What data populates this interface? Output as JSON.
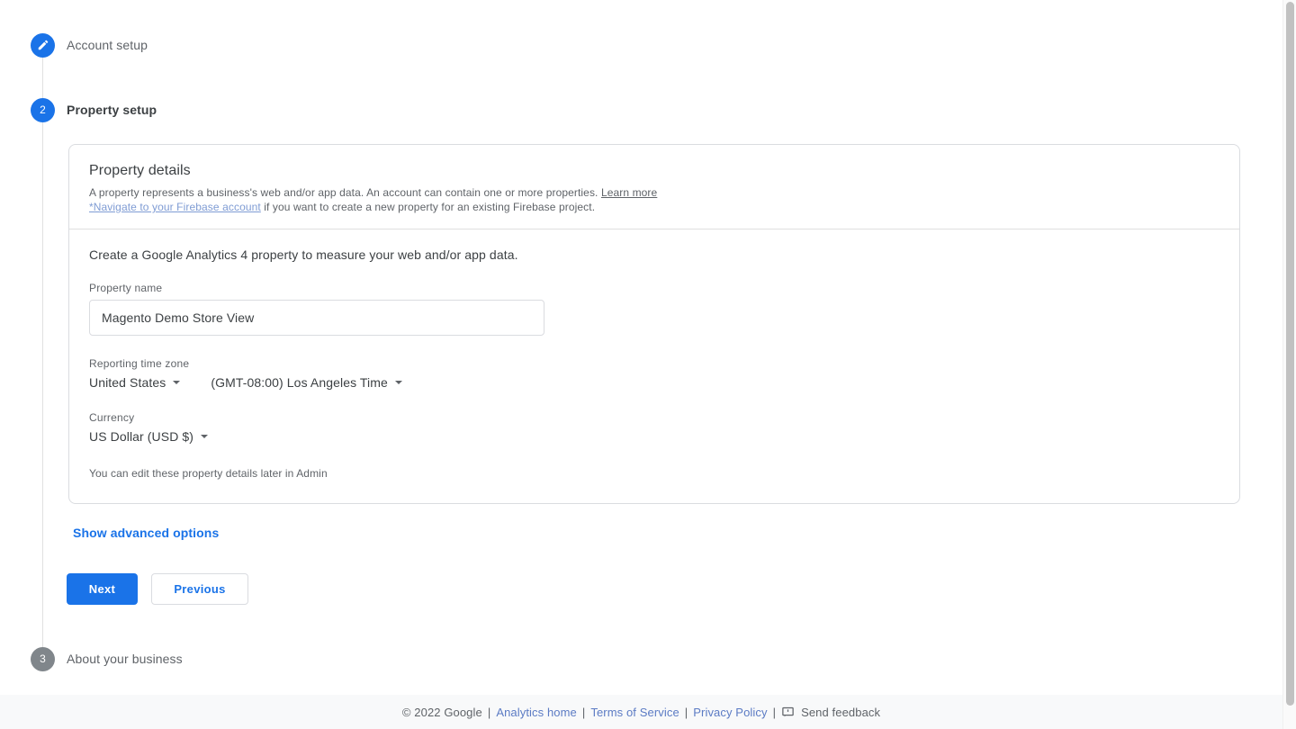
{
  "stepper": {
    "steps": [
      {
        "id": "account-setup",
        "badge": "check-edit",
        "label": "Account setup",
        "state": "completed"
      },
      {
        "id": "property-setup",
        "badge": "2",
        "label": "Property setup",
        "state": "active"
      },
      {
        "id": "about-your-business",
        "badge": "3",
        "label": "About your business",
        "state": "pending"
      }
    ]
  },
  "card": {
    "title": "Property details",
    "description_line1_a": "A property represents a business's web and/or app data. An account can contain one or more properties. ",
    "description_learn_more": "Learn more",
    "description_line2_link": "*Navigate to your Firebase account",
    "description_line2_rest": " if you want to create a new property for an existing Firebase project.",
    "intro": "Create a Google Analytics 4 property to measure your web and/or app data.",
    "property_name_label": "Property name",
    "property_name_value": "Magento Demo Store View",
    "property_name_placeholder": "Property name",
    "timezone_label": "Reporting time zone",
    "timezone_country": "United States",
    "timezone_zone": "(GMT-08:00) Los Angeles Time",
    "currency_label": "Currency",
    "currency_value": "US Dollar (USD $)",
    "note": "You can edit these property details later in Admin"
  },
  "advanced": {
    "show_advanced_label": "Show advanced options"
  },
  "actions": {
    "next_label": "Next",
    "previous_label": "Previous"
  },
  "footer": {
    "copyright": "© 2022 Google",
    "separator": "|",
    "analytics_home": "Analytics home",
    "terms_of_service": "Terms of Service",
    "privacy_policy": "Privacy Policy",
    "send_feedback": "Send feedback"
  },
  "colors": {
    "accent_blue": "#1a73e8",
    "pending_gray": "#80868b",
    "text_primary": "#3c4043",
    "text_secondary": "#5f6368",
    "border": "#dadce0",
    "footer_bg": "#f8f9fa",
    "footer_link": "#5b7bc4"
  }
}
